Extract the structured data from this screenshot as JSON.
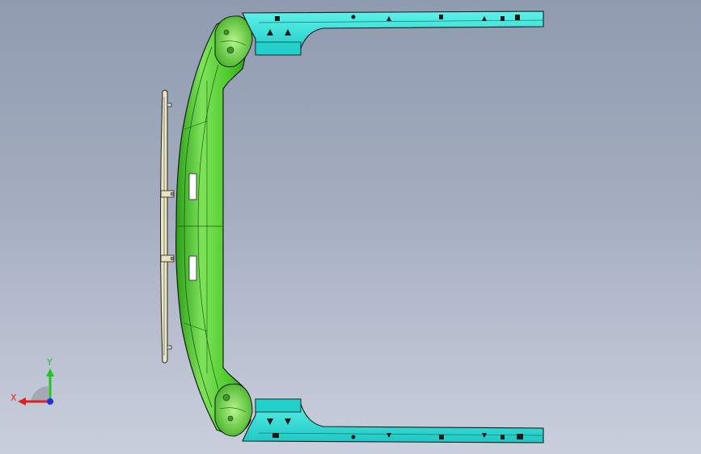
{
  "viewport": {
    "background_top": "#8f9bb0",
    "background_bottom": "#c9cfdc"
  },
  "model": {
    "bumper_color": "#49c72a",
    "bumper_highlight": "#a8f07a",
    "bracket_color": "#2ee0d8",
    "bracket_shadow": "#15a9a6",
    "grille_color": "#ece6c2",
    "edge_color": "#1a1a1a"
  },
  "triad": {
    "x_label": "X",
    "y_label": "Y",
    "x_color": "#e02020",
    "y_color": "#22c322",
    "z_color": "#2030e0"
  }
}
